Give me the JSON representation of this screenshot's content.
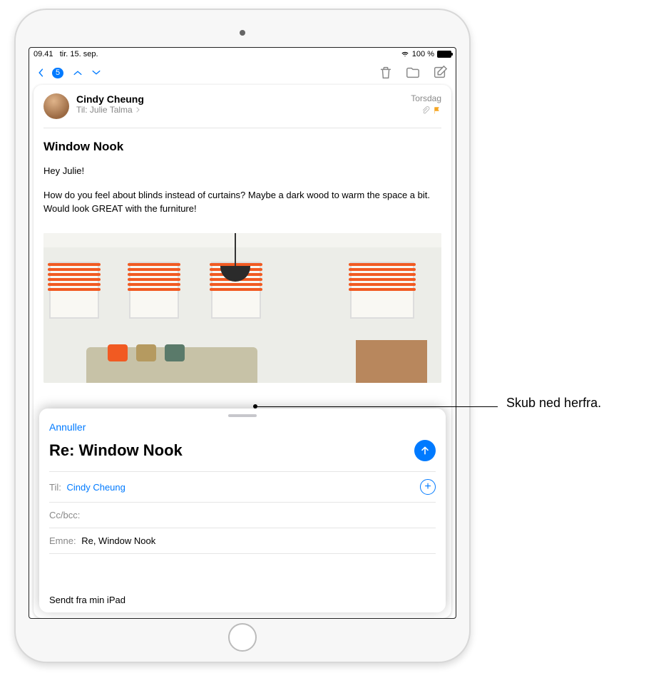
{
  "statusbar": {
    "time": "09.41",
    "date": "tir. 15. sep.",
    "battery": "100 %"
  },
  "nav": {
    "badge": "5"
  },
  "message": {
    "sender": "Cindy Cheung",
    "to_label": "Til:",
    "recipient": "Julie Talma",
    "date": "Torsdag",
    "subject": "Window Nook",
    "greeting": "Hey Julie!",
    "body": "How do you feel about blinds instead of curtains? Maybe a dark wood to warm the space a bit. Would look GREAT with the furniture!"
  },
  "compose": {
    "cancel": "Annuller",
    "title": "Re: Window Nook",
    "to_label": "Til:",
    "to_value": "Cindy Cheung",
    "cc_label": "Cc/bcc:",
    "subject_label": "Emne:",
    "subject_value": "Re, Window Nook",
    "signature": "Sendt fra min iPad"
  },
  "callout": {
    "text": "Skub ned herfra."
  }
}
